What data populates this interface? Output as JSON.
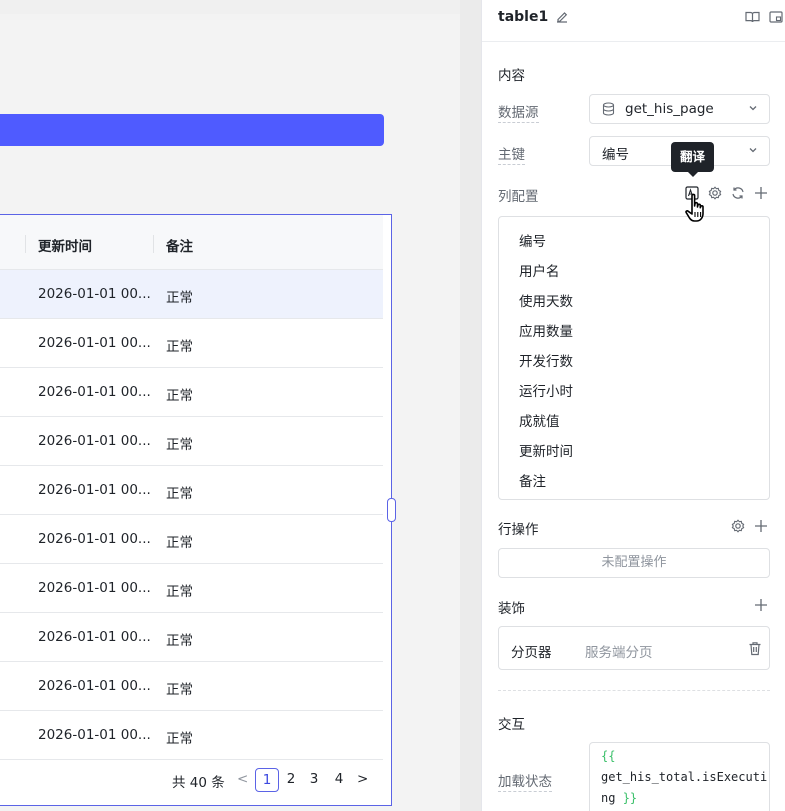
{
  "table": {
    "headers": [
      "更新时间",
      "备注"
    ],
    "rows": [
      {
        "updated": "2026-01-01 00...",
        "note": "正常"
      },
      {
        "updated": "2026-01-01 00...",
        "note": "正常"
      },
      {
        "updated": "2026-01-01 00...",
        "note": "正常"
      },
      {
        "updated": "2026-01-01 00...",
        "note": "正常"
      },
      {
        "updated": "2026-01-01 00...",
        "note": "正常"
      },
      {
        "updated": "2026-01-01 00...",
        "note": "正常"
      },
      {
        "updated": "2026-01-01 00...",
        "note": "正常"
      },
      {
        "updated": "2026-01-01 00...",
        "note": "正常"
      },
      {
        "updated": "2026-01-01 00...",
        "note": "正常"
      },
      {
        "updated": "2026-01-01 00...",
        "note": "正常"
      }
    ],
    "pager": {
      "total": "共 40 条",
      "pages": [
        "1",
        "2",
        "3",
        "4"
      ],
      "current": "1",
      "prev": "<",
      "next": ">"
    }
  },
  "panel": {
    "title": "table1",
    "content": {
      "section": "内容",
      "datasource_label": "数据源",
      "datasource_value": "get_his_page",
      "primary_key_label": "主键",
      "primary_key_value": "编号",
      "columns_label": "列配置",
      "tooltip": "翻译",
      "columns": [
        "编号",
        "用户名",
        "使用天数",
        "应用数量",
        "开发行数",
        "运行小时",
        "成就值",
        "更新时间",
        "备注"
      ]
    },
    "row_actions": {
      "label": "行操作",
      "empty": "未配置操作"
    },
    "decoration": {
      "label": "装饰",
      "item_name": "分页器",
      "item_value": "服务端分页"
    },
    "interaction": {
      "label": "交互",
      "loading_label": "加载状态",
      "open_brace": "{{",
      "expression": "get_his_total.isExecuting",
      "close_brace": "}}"
    }
  },
  "colors": {
    "accent": "#4f5bff",
    "selection_border": "#5b63e6",
    "selected_row": "#eef2fd"
  }
}
